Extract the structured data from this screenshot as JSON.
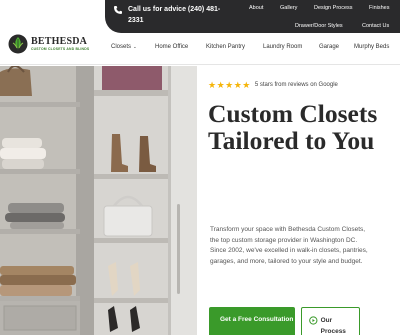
{
  "topbar": {
    "phone_label": "Call us for advice (240) 481-2331",
    "links": [
      "About",
      "Gallery",
      "Design Process",
      "Finishes",
      "Drawer/Door Styles",
      "Contact Us"
    ],
    "dark_color": "#2a2a2c"
  },
  "brand": {
    "name": "BETHESDA",
    "tagline": "CUSTOM CLOSETS AND BLINDS",
    "colors": {
      "green": "#3a9a2a",
      "dark": "#2a2a2a"
    }
  },
  "nav": {
    "items": [
      {
        "label": "Closets",
        "has_dropdown": true,
        "icon": "chevron-down-icon"
      },
      {
        "label": "Home Office"
      },
      {
        "label": "Kitchen Pantry"
      },
      {
        "label": "Laundry Room"
      },
      {
        "label": "Garage"
      },
      {
        "label": "Murphy Beds"
      }
    ]
  },
  "hero": {
    "rating_stars": 5,
    "stars_text": "★★★★★",
    "rating_text": "5 stars from reviews on Google",
    "headline": "Custom Closets Tailored to You",
    "intro": "Transform your space with Bethesda Custom Closets, the top custom storage provider in Washington DC. Since 2002, we've excelled in walk-in closets, pantries, garages, and more, tailored to your style and budget.",
    "primary_button": "Get a Free Consultation",
    "secondary_button": "Our Process",
    "star_color": "#f5b50a",
    "image": "closet-photo"
  }
}
